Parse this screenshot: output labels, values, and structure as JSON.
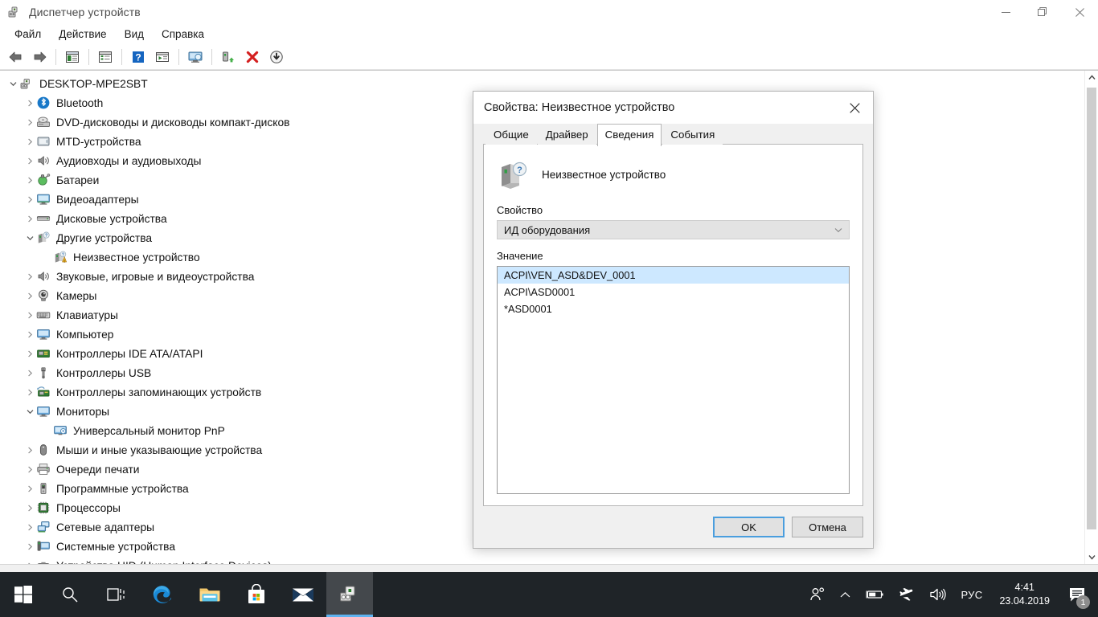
{
  "window": {
    "title": "Диспетчер устройств",
    "icon": "device-manager-icon",
    "minimize_label": "—",
    "maximize_label": "❐",
    "close_label": "✕"
  },
  "menu": {
    "items": [
      {
        "label": "Файл",
        "name": "menu-file"
      },
      {
        "label": "Действие",
        "name": "menu-action"
      },
      {
        "label": "Вид",
        "name": "menu-view"
      },
      {
        "label": "Справка",
        "name": "menu-help"
      }
    ]
  },
  "toolbar": {
    "buttons": [
      {
        "name": "back-arrow-icon",
        "tooltip": "Назад"
      },
      {
        "name": "forward-arrow-icon",
        "tooltip": "Вперед"
      },
      {
        "name": "show-hide-console-tree-icon",
        "tooltip": "Показать/скрыть дерево консоли"
      },
      {
        "name": "properties-icon",
        "tooltip": "Свойства"
      },
      {
        "name": "help-icon",
        "tooltip": "Справка"
      },
      {
        "name": "scan-hardware-changes-icon",
        "tooltip": "Обновить конфигурацию оборудования"
      },
      {
        "name": "display-icon",
        "tooltip": "Экран"
      },
      {
        "name": "update-driver-icon",
        "tooltip": "Обновить драйвер"
      },
      {
        "name": "uninstall-device-icon",
        "tooltip": "Удалить устройство"
      },
      {
        "name": "disable-device-icon",
        "tooltip": "Отключить устройство"
      }
    ]
  },
  "tree": {
    "items": [
      {
        "label": "DESKTOP-MPE2SBT",
        "level": 0,
        "state": "expanded",
        "icon": "computer-root-icon"
      },
      {
        "label": "Bluetooth",
        "level": 1,
        "state": "collapsed",
        "icon": "bluetooth-icon"
      },
      {
        "label": "DVD-дисководы и дисководы компакт-дисков",
        "level": 1,
        "state": "collapsed",
        "icon": "dvd-drive-icon"
      },
      {
        "label": "MTD-устройства",
        "level": 1,
        "state": "collapsed",
        "icon": "mtd-device-icon"
      },
      {
        "label": "Аудиовходы и аудиовыходы",
        "level": 1,
        "state": "collapsed",
        "icon": "audio-io-icon"
      },
      {
        "label": "Батареи",
        "level": 1,
        "state": "collapsed",
        "icon": "battery-icon"
      },
      {
        "label": "Видеоадаптеры",
        "level": 1,
        "state": "collapsed",
        "icon": "display-adapter-icon"
      },
      {
        "label": "Дисковые устройства",
        "level": 1,
        "state": "collapsed",
        "icon": "disk-drive-icon"
      },
      {
        "label": "Другие устройства",
        "level": 1,
        "state": "expanded",
        "icon": "other-device-icon"
      },
      {
        "label": "Неизвестное устройство",
        "level": 2,
        "state": "leaf",
        "icon": "unknown-device-warning-icon"
      },
      {
        "label": "Звуковые, игровые и видеоустройства",
        "level": 1,
        "state": "collapsed",
        "icon": "sound-video-icon"
      },
      {
        "label": "Камеры",
        "level": 1,
        "state": "collapsed",
        "icon": "camera-icon"
      },
      {
        "label": "Клавиатуры",
        "level": 1,
        "state": "collapsed",
        "icon": "keyboard-icon"
      },
      {
        "label": "Компьютер",
        "level": 1,
        "state": "collapsed",
        "icon": "computer-icon"
      },
      {
        "label": "Контроллеры IDE ATA/ATAPI",
        "level": 1,
        "state": "collapsed",
        "icon": "ide-controller-icon"
      },
      {
        "label": "Контроллеры USB",
        "level": 1,
        "state": "collapsed",
        "icon": "usb-controller-icon"
      },
      {
        "label": "Контроллеры запоминающих устройств",
        "level": 1,
        "state": "collapsed",
        "icon": "storage-controller-icon"
      },
      {
        "label": "Мониторы",
        "level": 1,
        "state": "expanded",
        "icon": "monitor-icon"
      },
      {
        "label": "Универсальный монитор PnP",
        "level": 2,
        "state": "leaf",
        "icon": "pnp-monitor-icon"
      },
      {
        "label": "Мыши и иные указывающие устройства",
        "level": 1,
        "state": "collapsed",
        "icon": "mouse-icon"
      },
      {
        "label": "Очереди печати",
        "level": 1,
        "state": "collapsed",
        "icon": "printer-icon"
      },
      {
        "label": "Программные устройства",
        "level": 1,
        "state": "collapsed",
        "icon": "software-device-icon"
      },
      {
        "label": "Процессоры",
        "level": 1,
        "state": "collapsed",
        "icon": "processor-icon"
      },
      {
        "label": "Сетевые адаптеры",
        "level": 1,
        "state": "collapsed",
        "icon": "network-adapter-icon"
      },
      {
        "label": "Системные устройства",
        "level": 1,
        "state": "collapsed",
        "icon": "system-device-icon"
      },
      {
        "label": "Устройства HID (Human Interface Devices)",
        "level": 1,
        "state": "collapsed",
        "icon": "hid-device-icon"
      }
    ]
  },
  "dialog": {
    "title": "Свойства: Неизвестное устройство",
    "close_label": "✕",
    "tabs": [
      {
        "label": "Общие",
        "name": "tab-general",
        "active": false
      },
      {
        "label": "Драйвер",
        "name": "tab-driver",
        "active": false
      },
      {
        "label": "Сведения",
        "name": "tab-details",
        "active": true
      },
      {
        "label": "События",
        "name": "tab-events",
        "active": false
      }
    ],
    "device_name": "Неизвестное устройство",
    "device_icon": "unknown-device-icon",
    "property_label": "Свойство",
    "property_selected": "ИД оборудования",
    "value_label": "Значение",
    "values": [
      {
        "text": "ACPI\\VEN_ASD&DEV_0001",
        "selected": true
      },
      {
        "text": "ACPI\\ASD0001",
        "selected": false
      },
      {
        "text": "*ASD0001",
        "selected": false
      }
    ],
    "ok_label": "OK",
    "cancel_label": "Отмена"
  },
  "taskbar": {
    "apps": [
      {
        "name": "start-button",
        "icon": "windows-logo-icon",
        "active": false
      },
      {
        "name": "search-button",
        "icon": "search-icon",
        "active": false
      },
      {
        "name": "task-view-button",
        "icon": "task-view-icon",
        "active": false
      },
      {
        "name": "edge-button",
        "icon": "edge-icon",
        "active": false
      },
      {
        "name": "file-explorer-button",
        "icon": "folder-icon",
        "active": false
      },
      {
        "name": "microsoft-store-button",
        "icon": "store-bag-icon",
        "active": false
      },
      {
        "name": "mail-button",
        "icon": "mail-envelope-icon",
        "active": false
      },
      {
        "name": "device-manager-taskbar-button",
        "icon": "device-manager-icon",
        "active": true
      }
    ],
    "tray": {
      "people_icon": "people-icon",
      "chevron_icon": "chevron-up-icon",
      "battery_icon": "battery-icon",
      "airplane_icon": "airplane-mode-icon",
      "volume_icon": "volume-icon",
      "language": "РУС",
      "time": "4:41",
      "date": "23.04.2019",
      "notification_icon": "notification-icon",
      "notification_count": "1"
    }
  },
  "colors": {
    "accent": "#4a9ede",
    "selection": "#cde8ff",
    "taskbar": "#1f2428",
    "dialog_bg": "#f0f0f0"
  }
}
